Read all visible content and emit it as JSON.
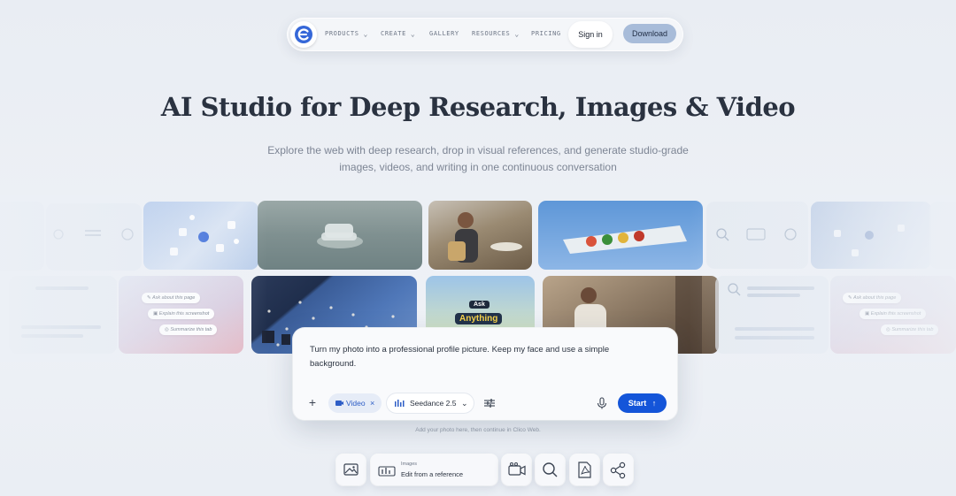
{
  "nav": {
    "items": [
      {
        "label": "PRODUCTS",
        "has_menu": true
      },
      {
        "label": "CREATE",
        "has_menu": true
      },
      {
        "label": "GALLERY",
        "has_menu": false
      },
      {
        "label": "RESOURCES",
        "has_menu": true
      },
      {
        "label": "PRICING",
        "has_menu": false
      }
    ],
    "sign_in": "Sign in",
    "download": "Download"
  },
  "hero": {
    "title": "AI Studio for Deep Research, Images & Video",
    "subtitle_line1": "Explore the web with deep research, drop in visual references, and generate studio-grade",
    "subtitle_line2": "images, videos, and writing in one continuous conversation"
  },
  "gallery": {
    "left_chips": [
      "Ask about this page",
      "Explain this screenshot",
      "Summarize this tab"
    ],
    "right_chips": [
      "Ask about this page",
      "Explain this screenshot",
      "Summarize this tab"
    ],
    "ask_badge_top": "Ask",
    "ask_badge_bottom": "Anything"
  },
  "composer": {
    "prompt_line1": "Turn my photo into a professional profile picture. Keep my face and use a simple",
    "prompt_line2": "background.",
    "mode_chip": "Video",
    "model": "Seedance 2.5",
    "start_label": "Start",
    "hint": "Add your photo here, then continue in Clico Web."
  },
  "toolbar": {
    "edit_tag": "Images",
    "edit_label": "Edit from a reference"
  },
  "colors": {
    "accent": "#1455d9",
    "download_bg": "#a8bcd9",
    "video_chip": "#2d5dc6",
    "background": "#eef1f6"
  },
  "icons": [
    "logo-icon",
    "chevron-down-icon",
    "plus-icon",
    "video-icon",
    "close-icon",
    "waveform-icon",
    "sliders-icon",
    "mic-icon",
    "arrow-up-icon",
    "image-icon",
    "chart-icon",
    "video-camera-icon",
    "search-icon",
    "pdf-icon",
    "share-icon"
  ]
}
